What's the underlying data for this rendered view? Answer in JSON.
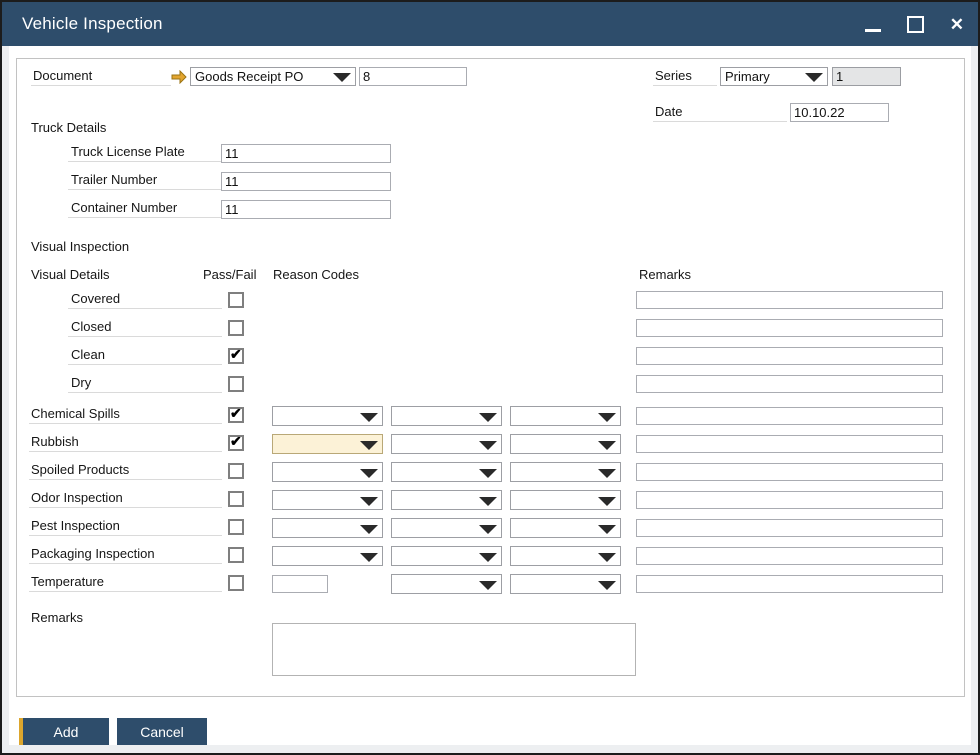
{
  "window": {
    "title": "Vehicle Inspection"
  },
  "icons": {
    "link_arrow": "link-arrow",
    "dropdown_arrow": "dropdown-arrow",
    "checkmark": "✔",
    "minimize": "minimize",
    "maximize": "maximize",
    "close": "✕"
  },
  "colors": {
    "titlebar": "#2e4d6b",
    "accent_gold": "#dca62d",
    "button": "#2e4d6b",
    "focused_field": "#fcf2d7",
    "field_border": "#aaacb2"
  },
  "document_row": {
    "label": "Document",
    "type_value": "Goods Receipt PO",
    "number_value": "8"
  },
  "series_row": {
    "label": "Series",
    "value": "Primary",
    "number": "1"
  },
  "date_row": {
    "label": "Date",
    "value": "10.10.22"
  },
  "truck_details": {
    "title": "Truck Details",
    "fields": [
      {
        "label": "Truck License Plate",
        "value": "11"
      },
      {
        "label": "Trailer Number",
        "value": "11"
      },
      {
        "label": "Container Number",
        "value": "11"
      }
    ]
  },
  "visual_inspection": {
    "title": "Visual Inspection",
    "headers": {
      "details": "Visual Details",
      "pass_fail": "Pass/Fail",
      "reason_codes": "Reason Codes",
      "remarks": "Remarks"
    },
    "simple_rows": [
      {
        "label": "Covered",
        "checked": false,
        "remarks": ""
      },
      {
        "label": "Closed",
        "checked": false,
        "remarks": ""
      },
      {
        "label": "Clean",
        "checked": true,
        "remarks": ""
      },
      {
        "label": "Dry",
        "checked": false,
        "remarks": ""
      }
    ],
    "code_rows": [
      {
        "label": "Chemical Spills",
        "checked": true,
        "reason_codes": [
          "",
          "",
          ""
        ],
        "remarks": ""
      },
      {
        "label": "Rubbish",
        "checked": true,
        "reason_codes": [
          "",
          "",
          ""
        ],
        "remarks": "",
        "focused_field": true
      },
      {
        "label": "Spoiled Products",
        "checked": false,
        "reason_codes": [
          "",
          "",
          ""
        ],
        "remarks": ""
      },
      {
        "label": "Odor Inspection",
        "checked": false,
        "reason_codes": [
          "",
          "",
          ""
        ],
        "remarks": ""
      },
      {
        "label": "Pest Inspection",
        "checked": false,
        "reason_codes": [
          "",
          "",
          ""
        ],
        "remarks": ""
      },
      {
        "label": "Packaging Inspection",
        "checked": false,
        "reason_codes": [
          "",
          "",
          ""
        ],
        "remarks": ""
      },
      {
        "label": "Temperature",
        "checked": false,
        "temperature_value": "",
        "reason_codes": [
          "",
          ""
        ],
        "remarks": ""
      }
    ]
  },
  "remarks_section": {
    "label": "Remarks",
    "value": ""
  },
  "footer": {
    "add": "Add",
    "cancel": "Cancel"
  }
}
